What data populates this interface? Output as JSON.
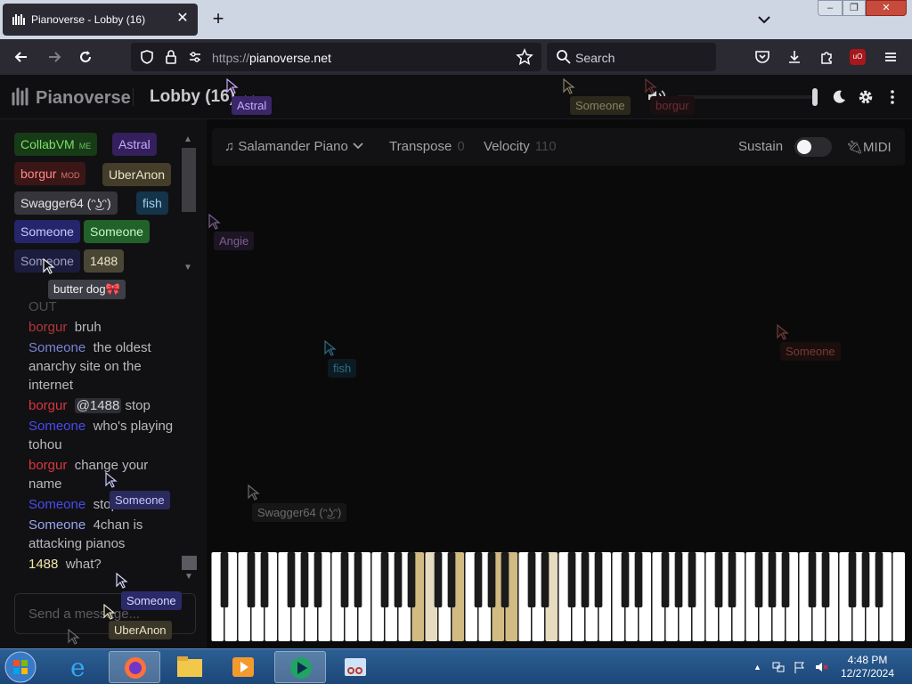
{
  "browser": {
    "tab_title": "Pianoverse - Lobby (16)",
    "url_scheme": "https://",
    "url_host": "pianoverse.net",
    "search_placeholder": "Search"
  },
  "site": {
    "brand": "Pianoverse",
    "room": "Lobby (16)"
  },
  "users": [
    {
      "name": "CollabVM",
      "tag": "ME",
      "color": "#7ee06a",
      "bg": "#173a17"
    },
    {
      "name": "Astral",
      "tag": "",
      "color": "#c9a8ff",
      "bg": "#33205c"
    },
    {
      "name": "borgur",
      "tag": "MOD",
      "color": "#ff8a8a",
      "bg": "#3b1616"
    },
    {
      "name": "UberAnon",
      "tag": "",
      "color": "#ebe3c6",
      "bg": "#433d2a"
    },
    {
      "name": "Swagger64 (ᵔ͜ʖᵔ)",
      "tag": "",
      "color": "#e3e3e8",
      "bg": "#35353b"
    },
    {
      "name": "fish",
      "tag": "",
      "color": "#9fd0ee",
      "bg": "#15344a"
    },
    {
      "name": "Someone",
      "tag": "",
      "color": "#c7c7ff",
      "bg": "#25256c"
    },
    {
      "name": "Someone",
      "tag": "",
      "color": "#c8f5c0",
      "bg": "#21612a"
    },
    {
      "name": "Someone",
      "tag": "",
      "color": "#a0a0c8",
      "bg": "#1c1c3c"
    },
    {
      "name": "1488",
      "tag": "",
      "color": "#ece4c4",
      "bg": "#4a4636"
    }
  ],
  "chat": {
    "partial_top": "OUT",
    "messages": [
      {
        "name": "borgur",
        "color": "#b4363a",
        "text": "bruh"
      },
      {
        "name": "Someone",
        "color": "#7a83d6",
        "text": "the oldest anarchy site on the internet"
      },
      {
        "name": "borgur",
        "color": "#d9363e",
        "mention": "@1488",
        "text": "stop"
      },
      {
        "name": "Someone",
        "color": "#4a4af2",
        "text": "who's playing tohou"
      },
      {
        "name": "borgur",
        "color": "#d9363e",
        "text": "change your name"
      },
      {
        "name": "Someone",
        "color": "#4a4af2",
        "text": "stop it"
      },
      {
        "name": "Someone",
        "color": "#9aa5ee",
        "text": "4chan is attacking pianos"
      },
      {
        "name": "1488",
        "color": "#f2e7a8",
        "text": "what?"
      }
    ],
    "input_placeholder": "Send a message..."
  },
  "toolbar": {
    "instrument": "Salamander Piano",
    "transpose_label": "Transpose",
    "transpose_value": "0",
    "velocity_label": "Velocity",
    "velocity_value": "110",
    "sustain_label": "Sustain",
    "sustain_on": false,
    "midi_label": "MIDI"
  },
  "cursors": [
    {
      "name": "Astral",
      "color": "#c9a8ff",
      "bg": "#3a2668"
    },
    {
      "name": "Someone",
      "color": "#8a8263",
      "bg": "#2b281c"
    },
    {
      "name": "borgur",
      "color": "#6b2f36",
      "bg": "#1b0f12"
    },
    {
      "name": "Angie",
      "color": "#7b5f8f",
      "bg": "#1d1524"
    },
    {
      "name": "fish",
      "color": "#2f6b86",
      "bg": "#0c1b22"
    },
    {
      "name": "Someone",
      "color": "#7a3a34",
      "bg": "#1a0f0d"
    },
    {
      "name": "Swagger64 (ᵔ͜ʖᵔ)",
      "color": "#6c6c70",
      "bg": "#161617"
    },
    {
      "name": "butter dog🎀",
      "color": "#f0f0f4",
      "bg": "#3e3e46"
    },
    {
      "name": "Someone",
      "color": "#c7c7ff",
      "bg": "#2a2a5c"
    },
    {
      "name": "Someone",
      "color": "#d7d7ff",
      "bg": "#2a2a6a"
    },
    {
      "name": "UberAnon",
      "color": "#ebe3c6",
      "bg": "#3a3628"
    },
    {
      "name": "Someone",
      "color": "#6a6a70",
      "bg": "#1a1a1c"
    }
  ],
  "piano": {
    "white_key_count": 52,
    "pressed_white": [
      15,
      18,
      21,
      22
    ],
    "dim_white": [
      16,
      25
    ],
    "pressed_color": "#d1bb83",
    "dim_color": "#e7dcc0"
  },
  "taskbar": {
    "time": "4:48 PM",
    "date": "12/27/2024"
  }
}
